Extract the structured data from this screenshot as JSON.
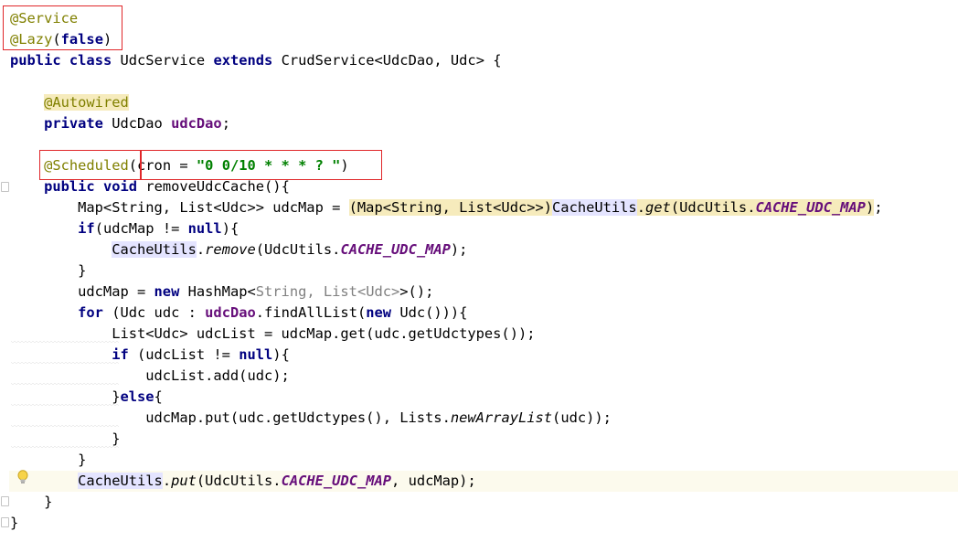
{
  "editor": {
    "lines": [
      [
        {
          "t": "@Service",
          "c": "ann"
        }
      ],
      [
        {
          "t": "@Lazy",
          "c": "ann"
        },
        {
          "t": "("
        },
        {
          "t": "false",
          "c": "kw"
        },
        {
          "t": ")"
        }
      ],
      [
        {
          "t": "public",
          "c": "kw"
        },
        {
          "t": " "
        },
        {
          "t": "class",
          "c": "kw"
        },
        {
          "t": " UdcService "
        },
        {
          "t": "extends",
          "c": "kw"
        },
        {
          "t": " CrudService<UdcDao, Udc> {"
        }
      ],
      [],
      [
        {
          "t": "    "
        },
        {
          "t": "@Autowired",
          "c": "ann-hl"
        }
      ],
      [
        {
          "t": "    "
        },
        {
          "t": "private",
          "c": "kw"
        },
        {
          "t": " UdcDao "
        },
        {
          "t": "udcDao",
          "c": "field"
        },
        {
          "t": ";"
        }
      ],
      [],
      [
        {
          "t": "    "
        },
        {
          "t": "@Scheduled",
          "c": "ann"
        },
        {
          "t": "(cron = "
        },
        {
          "t": "\"0 0/10 * * * ? \"",
          "c": "str"
        },
        {
          "t": ")"
        }
      ],
      [
        {
          "t": "    "
        },
        {
          "t": "public",
          "c": "kw"
        },
        {
          "t": " "
        },
        {
          "t": "void",
          "c": "kw"
        },
        {
          "t": " removeUdcCache(){"
        }
      ],
      [
        {
          "t": "        Map<String, List<Udc>> udcMap = "
        },
        {
          "t": "(Map<String, List<Udc>>)",
          "c": "cast"
        },
        {
          "t": "CacheUtils",
          "c": "hl-blue"
        },
        {
          "t": ".",
          "c": "cast"
        },
        {
          "t": "get",
          "c": "ital cast"
        },
        {
          "t": "(UdcUtils.",
          "c": "cast"
        },
        {
          "t": "CACHE_UDC_MAP",
          "c": "const cast"
        },
        {
          "t": ")",
          "c": "cast"
        },
        {
          "t": ";"
        }
      ],
      [
        {
          "t": "        "
        },
        {
          "t": "if",
          "c": "kw"
        },
        {
          "t": "(udcMap != "
        },
        {
          "t": "null",
          "c": "kw"
        },
        {
          "t": "){"
        }
      ],
      [
        {
          "t": "            "
        },
        {
          "t": "CacheUtils",
          "c": "hl-blue"
        },
        {
          "t": "."
        },
        {
          "t": "remove",
          "c": "ital"
        },
        {
          "t": "(UdcUtils."
        },
        {
          "t": "CACHE_UDC_MAP",
          "c": "const"
        },
        {
          "t": ");"
        }
      ],
      [
        {
          "t": "        }"
        }
      ],
      [
        {
          "t": "        udcMap = "
        },
        {
          "t": "new",
          "c": "kw"
        },
        {
          "t": " HashMap<"
        },
        {
          "t": "String, List<Udc>",
          "c": "gray"
        },
        {
          "t": ">();"
        }
      ],
      [
        {
          "t": "        "
        },
        {
          "t": "for",
          "c": "kw"
        },
        {
          "t": " (Udc udc : "
        },
        {
          "t": "udcDao",
          "c": "field"
        },
        {
          "t": ".findAllList("
        },
        {
          "t": "new",
          "c": "kw"
        },
        {
          "t": " Udc())){"
        }
      ],
      [
        {
          "t": "            List<Udc> udcList = udcMap.get(udc.getUdctypes());"
        }
      ],
      [
        {
          "t": "            "
        },
        {
          "t": "if",
          "c": "kw"
        },
        {
          "t": " (udcList != "
        },
        {
          "t": "null",
          "c": "kw"
        },
        {
          "t": "){"
        }
      ],
      [
        {
          "t": "                udcList.add(udc);"
        }
      ],
      [
        {
          "t": "            }"
        },
        {
          "t": "else",
          "c": "kw"
        },
        {
          "t": "{"
        }
      ],
      [
        {
          "t": "                udcMap.put(udc.getUdctypes(), Lists."
        },
        {
          "t": "newArrayList",
          "c": "ital"
        },
        {
          "t": "(udc));"
        }
      ],
      [
        {
          "t": "            }"
        }
      ],
      [
        {
          "t": "        }"
        }
      ],
      [
        {
          "t": "        "
        },
        {
          "t": "CacheUtils",
          "c": "hl-blue"
        },
        {
          "t": "."
        },
        {
          "t": "put",
          "c": "ital"
        },
        {
          "t": "(UdcUtils."
        },
        {
          "t": "CACHE_UDC_MAP",
          "c": "const"
        },
        {
          "t": ", udcMap);"
        }
      ],
      [
        {
          "t": "    }"
        }
      ],
      [
        {
          "t": "}"
        }
      ]
    ],
    "current_line": 22,
    "colors": {
      "keyword": "#000080",
      "annotation": "#808000",
      "field": "#660e7a",
      "string": "#008000",
      "current_line_bg": "#fcfaed",
      "highlight_box": "#e0272a"
    },
    "icons": [
      "intention-bulb-icon",
      "fold-marker-icon"
    ]
  }
}
